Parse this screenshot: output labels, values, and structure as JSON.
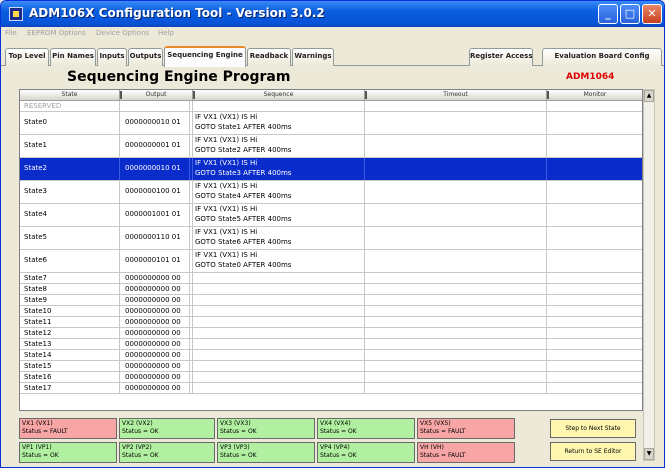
{
  "window": {
    "title": "ADM106X Configuration Tool - Version 3.0.2",
    "controls": {
      "minimize": "_",
      "maximize": "□",
      "close": "✕"
    }
  },
  "menu": [
    "File",
    "EEPROM Options",
    "Device Options",
    "Help"
  ],
  "tabs": [
    {
      "label": "Top Level",
      "active": false
    },
    {
      "label": "Pin Names",
      "active": false
    },
    {
      "label": "Inputs",
      "active": false
    },
    {
      "label": "Outputs",
      "active": false
    },
    {
      "label": "Sequencing Engine",
      "active": true
    },
    {
      "label": "Readback",
      "active": false
    },
    {
      "label": "Warnings",
      "active": false
    },
    {
      "label": "Register Access",
      "active": false
    },
    {
      "label": "Evaluation Board Config",
      "active": false
    }
  ],
  "page": {
    "title": "Sequencing Engine Program",
    "device": "ADM1064"
  },
  "grid": {
    "columns": [
      "State",
      "Output",
      "Sequence",
      "Timeout",
      "Monitor"
    ],
    "rows": [
      {
        "state": "RESERVED",
        "output": "",
        "seq1": "",
        "seq2": ""
      },
      {
        "state": "State0",
        "output": "0000000010 01",
        "seq1": "IF VX1 (VX1) IS Hi",
        "seq2": "GOTO State1 AFTER 400ms"
      },
      {
        "state": "State1",
        "output": "0000000001 01",
        "seq1": "IF VX1 (VX1) IS Hi",
        "seq2": "GOTO State2 AFTER 400ms"
      },
      {
        "state": "State2",
        "output": "0000000010 01",
        "seq1": "IF VX1 (VX1) IS Hi",
        "seq2": "GOTO State3 AFTER 400ms"
      },
      {
        "state": "State3",
        "output": "0000000100 01",
        "seq1": "IF VX1 (VX1) IS Hi",
        "seq2": "GOTO State4 AFTER 400ms"
      },
      {
        "state": "State4",
        "output": "0000001001 01",
        "seq1": "IF VX1 (VX1) IS Hi",
        "seq2": "GOTO State5 AFTER 400ms"
      },
      {
        "state": "State5",
        "output": "0000000110 01",
        "seq1": "IF VX1 (VX1) IS Hi",
        "seq2": "GOTO State6 AFTER 400ms"
      },
      {
        "state": "State6",
        "output": "0000000101 01",
        "seq1": "IF VX1 (VX1) IS Hi",
        "seq2": "GOTO State0 AFTER 400ms"
      },
      {
        "state": "State7",
        "output": "0000000000 00",
        "seq1": "",
        "seq2": ""
      },
      {
        "state": "State8",
        "output": "0000000000 00",
        "seq1": "",
        "seq2": ""
      },
      {
        "state": "State9",
        "output": "0000000000 00",
        "seq1": "",
        "seq2": ""
      },
      {
        "state": "State10",
        "output": "0000000000 00",
        "seq1": "",
        "seq2": ""
      },
      {
        "state": "State11",
        "output": "0000000000 00",
        "seq1": "",
        "seq2": ""
      },
      {
        "state": "State12",
        "output": "0000000000 00",
        "seq1": "",
        "seq2": ""
      },
      {
        "state": "State13",
        "output": "0000000000 00",
        "seq1": "",
        "seq2": ""
      },
      {
        "state": "State14",
        "output": "0000000000 00",
        "seq1": "",
        "seq2": ""
      },
      {
        "state": "State15",
        "output": "0000000000 00",
        "seq1": "",
        "seq2": ""
      },
      {
        "state": "State16",
        "output": "0000000000 00",
        "seq1": "",
        "seq2": ""
      },
      {
        "state": "State17",
        "output": "0000000000 00",
        "seq1": "",
        "seq2": ""
      }
    ],
    "selected_state": "State2"
  },
  "status": {
    "top": [
      {
        "name": "VX1 (VX1)",
        "status": "Status = FAULT",
        "fault": true
      },
      {
        "name": "VX2 (VX2)",
        "status": "Status = OK",
        "fault": false
      },
      {
        "name": "VX3 (VX3)",
        "status": "Status = OK",
        "fault": false
      },
      {
        "name": "VX4 (VX4)",
        "status": "Status = OK",
        "fault": false
      },
      {
        "name": "VX5 (VX5)",
        "status": "Status = FAULT",
        "fault": true
      }
    ],
    "bottom": [
      {
        "name": "VP1 (VP1)",
        "status": "Status = OK",
        "fault": false
      },
      {
        "name": "VP2 (VP2)",
        "status": "Status = OK",
        "fault": false
      },
      {
        "name": "VP3 (VP3)",
        "status": "Status = OK",
        "fault": false
      },
      {
        "name": "VP4 (VP4)",
        "status": "Status = OK",
        "fault": false
      },
      {
        "name": "VH (VH)",
        "status": "Status = FAULT",
        "fault": true
      }
    ]
  },
  "buttons": {
    "step": "Step to Next State",
    "return": "Return to SE Editor"
  },
  "colors": {
    "title_bar": "#0a5ee0",
    "selected_row": "#0a2ccb",
    "ok": "#b0f0a0",
    "fault": "#f7a5a5",
    "device_label": "#e00000",
    "action_button": "#fff7b0"
  }
}
